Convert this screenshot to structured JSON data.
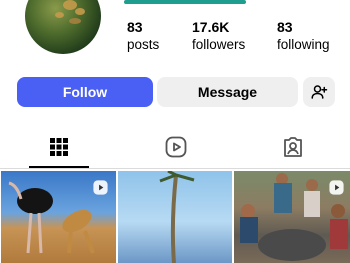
{
  "profile": {
    "stats": [
      {
        "value": "83",
        "label": "posts"
      },
      {
        "value": "17.6K",
        "label": "followers"
      },
      {
        "value": "83",
        "label": "following"
      }
    ]
  },
  "actions": {
    "follow_label": "Follow",
    "message_label": "Message",
    "add_user_icon": "add-person-icon"
  },
  "tabs": [
    {
      "icon": "grid-icon",
      "active": true
    },
    {
      "icon": "reels-icon",
      "active": false
    },
    {
      "icon": "tagged-icon",
      "active": false
    }
  ],
  "posts": [
    {
      "type": "reel",
      "icon": "reel-play-icon"
    },
    {
      "type": "photo"
    },
    {
      "type": "reel",
      "icon": "reel-play-icon"
    }
  ],
  "colors": {
    "accent": "#4a5ff3",
    "secondary_button": "#efefef",
    "highlight_bar": "#1f9e8f"
  }
}
